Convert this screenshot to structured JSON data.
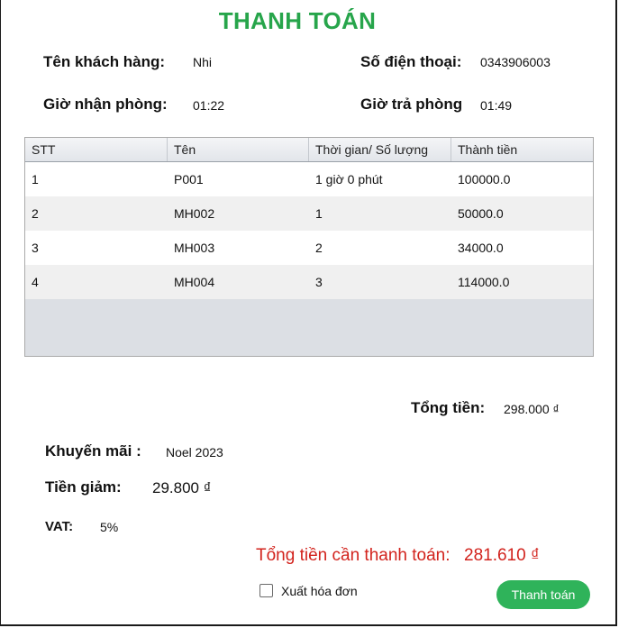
{
  "title": "THANH TOÁN",
  "customer": {
    "name_label": "Tên khách hàng:",
    "name": "Nhi",
    "phone_label": "Số điện thoại:",
    "phone": "0343906003"
  },
  "times": {
    "checkin_label": "Giờ nhận phòng:",
    "checkin": "01:22",
    "checkout_label": "Giờ trả phòng",
    "checkout": "01:49"
  },
  "table": {
    "headers": [
      "STT",
      "Tên",
      "Thời gian/ Số lượng",
      "Thành tiền"
    ],
    "rows": [
      [
        "1",
        "P001",
        "1 giờ 0 phút",
        "100000.0"
      ],
      [
        "2",
        "MH002",
        "1",
        "50000.0"
      ],
      [
        "3",
        "MH003",
        "2",
        "34000.0"
      ],
      [
        "4",
        "MH004",
        "3",
        "114000.0"
      ]
    ]
  },
  "summary": {
    "total_label": "Tổng tiền:",
    "total": "298.000 ₫",
    "promo_label": "Khuyến mãi :",
    "promo": "Noel 2023",
    "discount_label": "Tiền giảm:",
    "discount": "29.800 ₫",
    "vat_label": "VAT:",
    "vat": "5%",
    "grand_label": "Tổng tiền cần thanh toán:",
    "grand": "281.610 ₫"
  },
  "invoice_checkbox_label": "Xuất hóa đơn",
  "pay_button_label": "Thanh toán",
  "colors": {
    "title": "#27a54b",
    "grand_total": "#d2231d",
    "button": "#2fb35a"
  }
}
